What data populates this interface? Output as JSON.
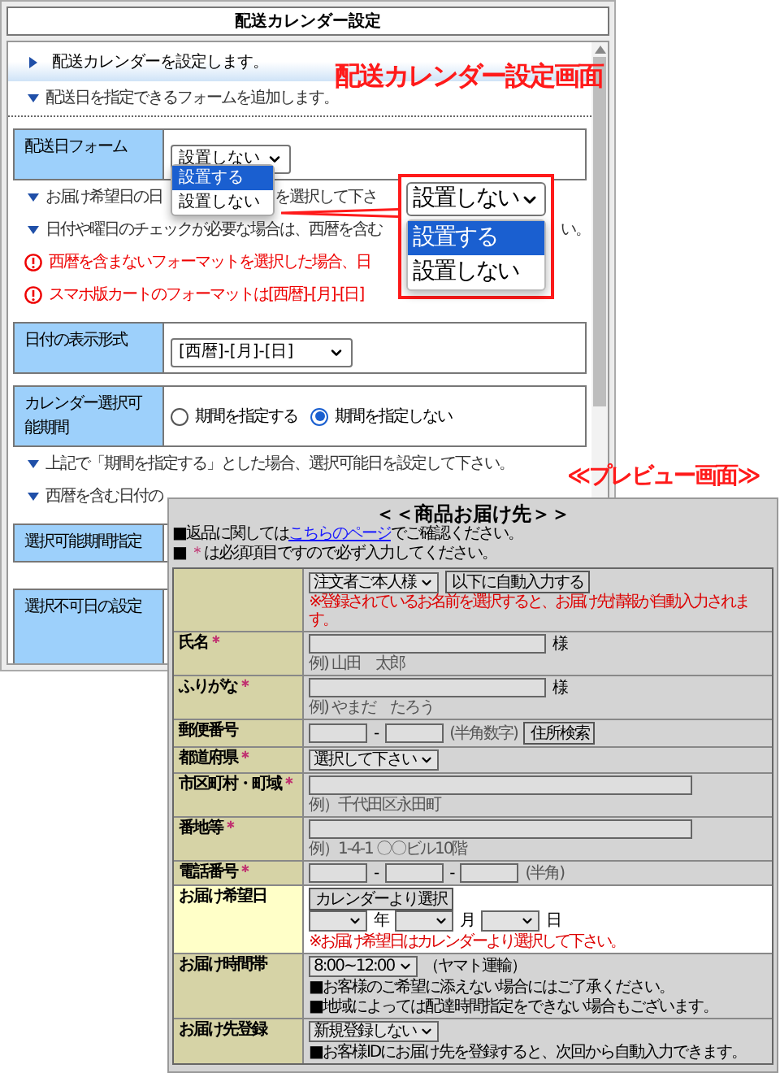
{
  "settings": {
    "title": "配送カレンダー設定",
    "items": [
      {
        "kind": "lead",
        "text": "配送カレンダーを設定します。"
      },
      {
        "kind": "note",
        "text": "配送日を指定できるフォームを追加します。"
      },
      {
        "kind": "field",
        "label": "配送日フォーム",
        "control": {
          "kind": "select",
          "value": "設置しない",
          "expanded": true,
          "options": [
            {
              "label": "設置する",
              "highlighted": true
            },
            {
              "label": "設置しない",
              "highlighted": false
            }
          ]
        }
      },
      {
        "kind": "hint",
        "text": "お届け希望日の日",
        "text_after": "を選択して下さ"
      },
      {
        "kind": "hint",
        "text": "日付や曜日のチェックが必要な場合は、西暦を含む",
        "text_after": "い。"
      },
      {
        "kind": "warning",
        "text": "西暦を含まないフォーマットを選択した場合、日"
      },
      {
        "kind": "warning",
        "text": "スマホ版カートのフォーマットは[西暦]-[月]-[日]"
      },
      {
        "kind": "field",
        "label": "日付の表示形式",
        "control": {
          "kind": "select",
          "value": "[西暦]-[月]-[日]",
          "expanded": false
        }
      },
      {
        "kind": "field",
        "label": "カレンダー選択可能期間",
        "control": {
          "kind": "radio",
          "options": [
            {
              "label": "期間を指定する",
              "selected": false
            },
            {
              "label": "期間を指定しない",
              "selected": true
            }
          ]
        }
      },
      {
        "kind": "hint",
        "text": "上記で「期間を指定する」とした場合、選択可能日を設定して下さい。"
      },
      {
        "kind": "hint",
        "text": "西暦を含む日付の"
      },
      {
        "kind": "field",
        "label": "選択可能期間指定"
      },
      {
        "kind": "field",
        "label": "選択不可日の設定"
      }
    ]
  },
  "annotations": {
    "settings_caption": "配送カレンダー設定画面",
    "preview_caption": "≪プレビュー画面≫",
    "zoom_callout": {
      "value": "設置しない",
      "options": [
        {
          "label": "設置する",
          "highlighted": true
        },
        {
          "label": "設置しない",
          "highlighted": false
        }
      ]
    }
  },
  "preview": {
    "title": "＜＜商品お届け先＞＞",
    "return_note": {
      "text": "■返品に関しては",
      "link": "こちらのページ",
      "text_after": "でご確認ください。"
    },
    "required_note": {
      "text": "■ ",
      "mark": "＊",
      "text_after": "は必須項目ですので必ず入力してください。"
    },
    "rows": [
      {
        "highlighted": false,
        "lines": [
          [
            {
              "kind": "select",
              "value": "注文者ご本人様"
            },
            {
              "kind": "button",
              "label": "以下に自動入力する"
            }
          ],
          [
            {
              "kind": "alert",
              "text": "※登録されているお名前を選択すると、お届け先情報が自動入力されます。"
            }
          ]
        ]
      },
      {
        "label": "氏名",
        "required_mark": "＊",
        "highlighted": false,
        "lines": [
          [
            {
              "kind": "input"
            },
            {
              "kind": "text",
              "text": "様"
            }
          ],
          [
            {
              "kind": "example",
              "text": "例) 山田　太郎"
            }
          ]
        ]
      },
      {
        "label": "ふりがな",
        "required_mark": "＊",
        "highlighted": false,
        "lines": [
          [
            {
              "kind": "input"
            },
            {
              "kind": "text",
              "text": "様"
            }
          ],
          [
            {
              "kind": "example",
              "text": "例) やまだ　たろう"
            }
          ]
        ]
      },
      {
        "label": "郵便番号",
        "highlighted": false,
        "lines": [
          [
            {
              "kind": "input"
            },
            {
              "kind": "text",
              "text": "-"
            },
            {
              "kind": "input"
            },
            {
              "kind": "example",
              "text": "(半角数字)"
            },
            {
              "kind": "button",
              "label": "住所検索"
            }
          ]
        ]
      },
      {
        "label": "都道府県",
        "required_mark": "＊",
        "highlighted": false,
        "lines": [
          [
            {
              "kind": "select",
              "value": "選択して下さい"
            }
          ]
        ]
      },
      {
        "label": "市区町村・町域",
        "required_mark": "＊",
        "highlighted": false,
        "lines": [
          [
            {
              "kind": "input"
            }
          ],
          [
            {
              "kind": "example",
              "text": "例）千代田区永田町"
            }
          ]
        ]
      },
      {
        "label": "番地等",
        "required_mark": "＊",
        "highlighted": false,
        "lines": [
          [
            {
              "kind": "input"
            }
          ],
          [
            {
              "kind": "example",
              "text": "例）1-4-1 〇〇ビル10階"
            }
          ]
        ]
      },
      {
        "label": "電話番号",
        "required_mark": "＊",
        "highlighted": false,
        "lines": [
          [
            {
              "kind": "input"
            },
            {
              "kind": "text",
              "text": "-"
            },
            {
              "kind": "input"
            },
            {
              "kind": "text",
              "text": "-"
            },
            {
              "kind": "input"
            },
            {
              "kind": "example",
              "text": "(半角)"
            }
          ]
        ]
      },
      {
        "label": "お届け希望日",
        "highlighted": true,
        "lines": [
          [
            {
              "kind": "button",
              "label": "カレンダーより選択"
            }
          ],
          [
            {
              "kind": "select"
            },
            {
              "kind": "text",
              "text": "年"
            },
            {
              "kind": "select"
            },
            {
              "kind": "text",
              "text": "月"
            },
            {
              "kind": "select"
            },
            {
              "kind": "text",
              "text": "日"
            }
          ],
          [
            {
              "kind": "alert",
              "text": "※お届け希望日はカレンダーより選択して下さい。"
            }
          ]
        ]
      },
      {
        "label": "お届け時間帯",
        "highlighted": false,
        "lines": [
          [
            {
              "kind": "select",
              "value": "8:00~12:00"
            },
            {
              "kind": "text",
              "text": "（ヤマト運輸）"
            }
          ],
          [
            {
              "kind": "text",
              "text": "■お客様のご希望に添えない場合にはご了承ください。"
            }
          ],
          [
            {
              "kind": "text",
              "text": "■地域によっては配達時間指定をできない場合もございます。"
            }
          ]
        ]
      },
      {
        "label": "お届け先登録",
        "highlighted": false,
        "lines": [
          [
            {
              "kind": "select",
              "value": "新規登録しない"
            }
          ],
          [
            {
              "kind": "text",
              "text": "■お客様IDにお届け先を登録すると、次回から自動入力できます。"
            }
          ]
        ]
      }
    ]
  }
}
